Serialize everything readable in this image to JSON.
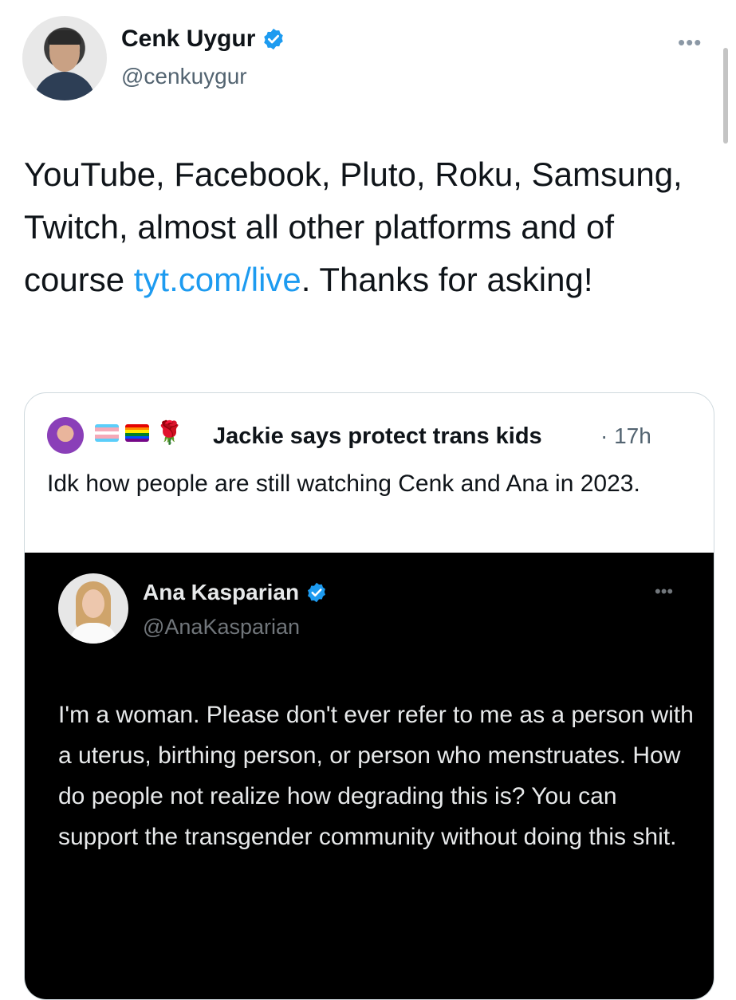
{
  "main_tweet": {
    "author_name": "Cenk Uygur",
    "author_handle": "@cenkuygur",
    "more_label": "•••",
    "text_before_link": "YouTube, Facebook, Pluto, Roku, Samsung, Twitch, almost all other platforms and of course ",
    "link_text": "tyt.com/live",
    "text_after_link": ". Thanks for asking!"
  },
  "quoted_tweet": {
    "author_name": "Jackie says protect trans kids",
    "timestamp": "· 17h",
    "text": "Idk how people are still watching Cenk and Ana in 2023.",
    "flags": [
      "transgender-flag",
      "rainbow-flag",
      "rose"
    ]
  },
  "embedded_screenshot": {
    "author_name": "Ana Kasparian",
    "author_handle": "@AnaKasparian",
    "more_label": "•••",
    "text": "I'm a woman. Please don't ever refer to me as a person with a uterus, birthing person, or person who menstruates. How do people not realize how degrading this is? You can support the transgender community without doing this shit."
  },
  "colors": {
    "link": "#1d9bf0",
    "verified": "#1d9bf0",
    "secondary_text": "#536471",
    "dark_background": "#000000"
  }
}
